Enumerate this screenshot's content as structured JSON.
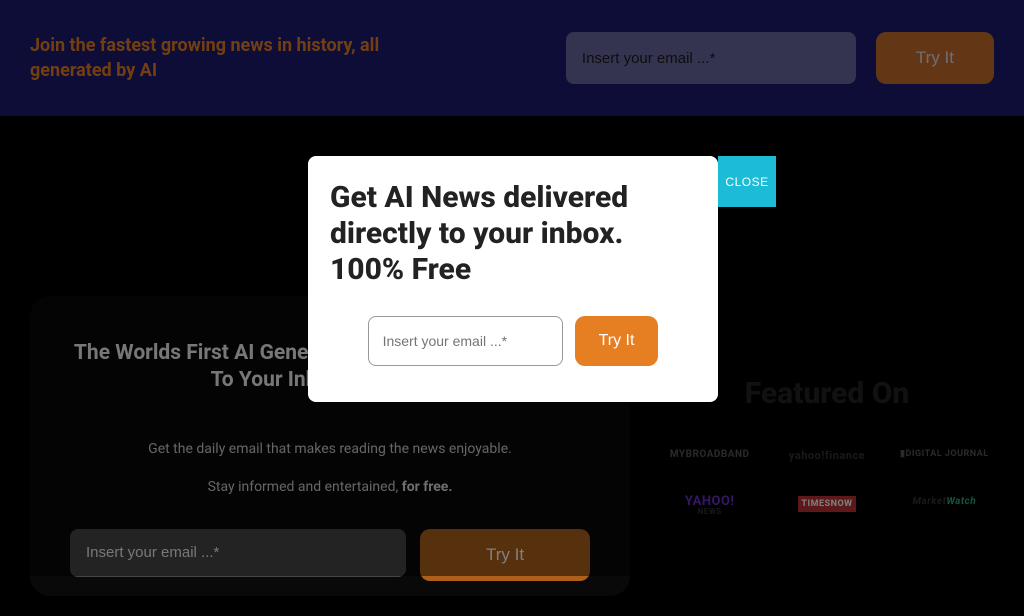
{
  "banner": {
    "headline": "Join the fastest growing news in history, all generated by AI",
    "email_placeholder": "Insert your email ...*",
    "cta_label": "Try It"
  },
  "hero": {
    "title_line": "The Worlds First AI Generated News Delivered Directly To Your Inbox. 100% Free",
    "sub1": "Get the daily email that makes reading the news enjoyable.",
    "sub2_prefix": "Stay informed and entertained, ",
    "sub2_bold": "for free.",
    "email_placeholder": "Insert your email ...*",
    "cta_label": "Try It"
  },
  "featured": {
    "title": "Featured On",
    "logos": {
      "mybroadband": "MYBROADBAND",
      "yahoo_finance_a": "yahoo!",
      "yahoo_finance_b": "finance",
      "digital_journal": "▮DIGITAL JOURNAL",
      "yahoo_news_a": "YAHOO!",
      "yahoo_news_b": "NEWS",
      "timesnow": "TIMESNOW",
      "marketwatch_a": "Market",
      "marketwatch_b": "Watch"
    }
  },
  "modal": {
    "title": "Get AI News delivered directly to your inbox. 100% Free",
    "email_placeholder": "Insert your email ...*",
    "cta_label": "Try It",
    "close_label": "CLOSE"
  }
}
